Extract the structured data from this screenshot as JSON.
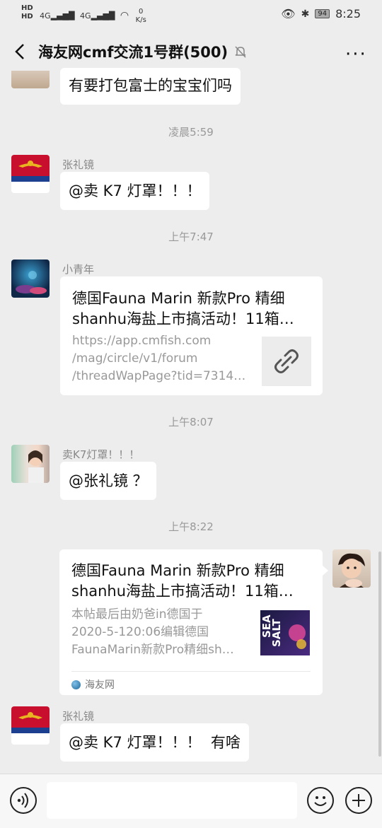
{
  "status": {
    "network": "HD 4G 4G",
    "speed": "0\nK/s",
    "battery": "94",
    "time": "8:25"
  },
  "header": {
    "title": "海友网cmf交流1号群(500)",
    "more": "···"
  },
  "messages": {
    "m0_text": "有要打包富士的宝宝们吗",
    "ts1": "凌晨5:59",
    "m1_sender": "张礼镜",
    "m1_text": "@卖 K7 灯罩！！！",
    "ts2": "上午7:47",
    "m2_sender": "小青年",
    "m2_title_line1": "德国Fauna Marin 新款Pro 精细",
    "m2_title_line2": "shanhu海盐上市搞活动！11箱…",
    "m2_url_line1": "https://app.cmfish.com",
    "m2_url_line2": "/mag/circle/v1/forum",
    "m2_url_line3": "/threadWapPage?tid=7314…",
    "ts3": "上午8:07",
    "m3_sender": "卖K7灯罩！！！",
    "m3_text": "@张礼镜 ？",
    "ts4": "上午8:22",
    "m4_title_line1": "德国Fauna Marin 新款Pro 精细",
    "m4_title_line2": "shanhu海盐上市搞活动！11箱…",
    "m4_desc_line1": "本帖最后由奶爸in德国于",
    "m4_desc_line2": "2020-5-120:06编辑德国",
    "m4_desc_line3": "FaunaMarin新款Pro精细sh…",
    "m4_source": "海友网",
    "m5_sender": "张礼镜",
    "m5_text": "@卖 K7 灯罩！！！  有啥"
  },
  "colors": {
    "background": "#ededed",
    "bubble": "#ffffff",
    "link_thumb": "#ececec"
  },
  "icons": [
    "back-icon",
    "mute-icon",
    "more-icon",
    "link-icon",
    "voice-icon",
    "emoji-icon",
    "plus-icon",
    "wifi-icon",
    "bluetooth-icon",
    "eye-icon"
  ]
}
